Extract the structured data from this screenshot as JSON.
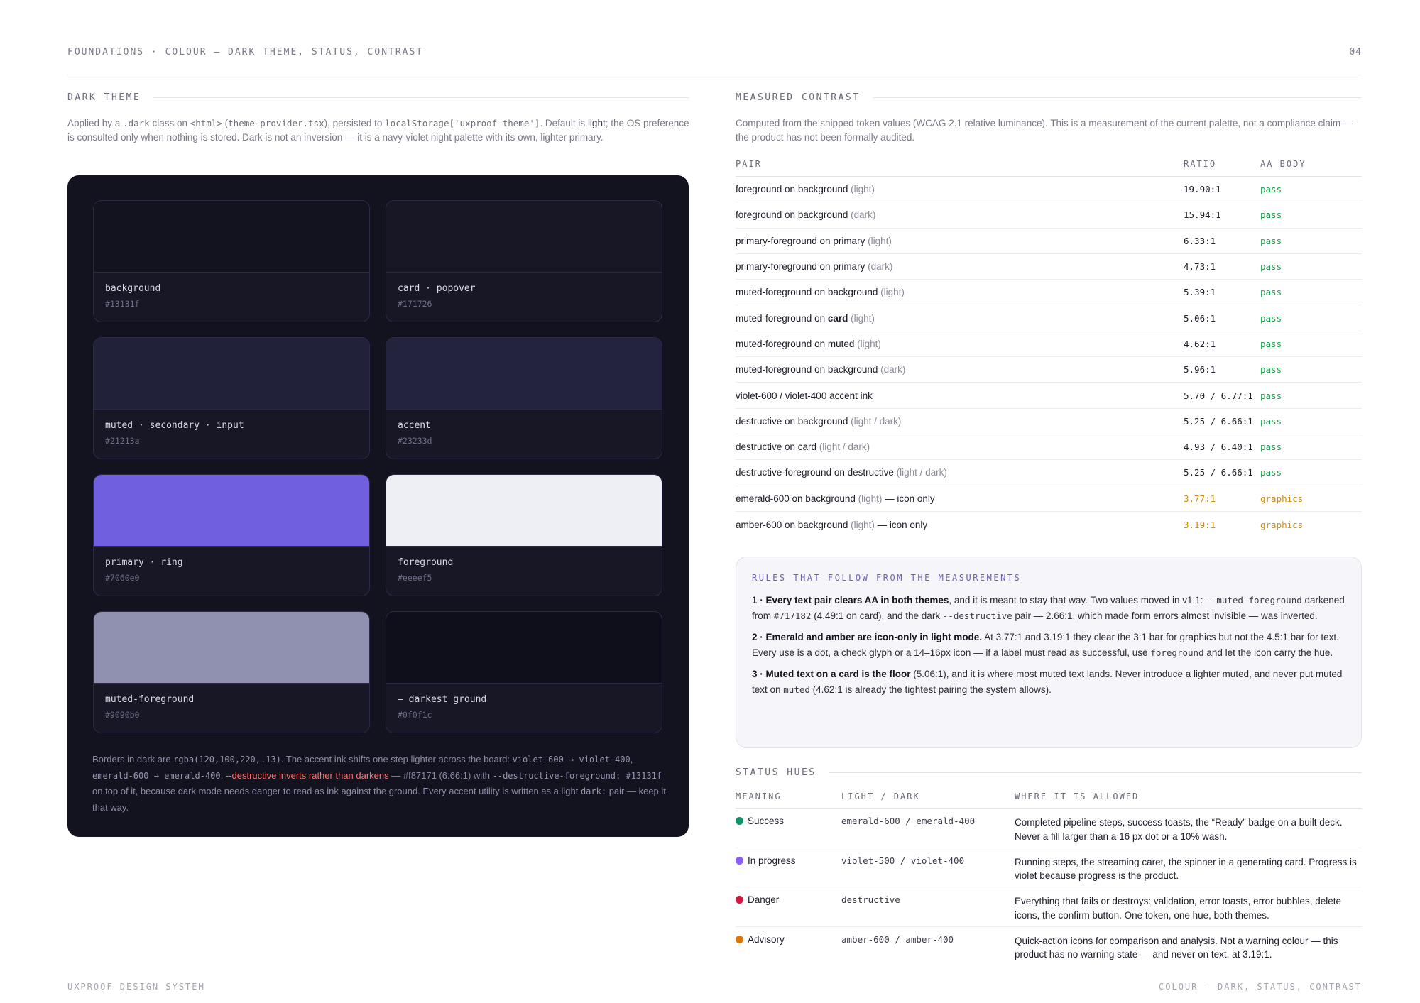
{
  "header": {
    "title": "FOUNDATIONS · COLOUR — DARK THEME, STATUS, CONTRAST",
    "page": "04"
  },
  "footer": {
    "left": "UXPROOF DESIGN SYSTEM",
    "right": "COLOUR — DARK, STATUS, CONTRAST"
  },
  "dark_theme": {
    "heading": "DARK THEME",
    "lead": [
      {
        "t": "Applied by a "
      },
      {
        "t": ".dark",
        "code": true
      },
      {
        "t": " class on "
      },
      {
        "t": "<html>",
        "code": true
      },
      {
        "t": " ("
      },
      {
        "t": "theme-provider.tsx",
        "code": true
      },
      {
        "t": "), persisted to "
      },
      {
        "t": "localStorage['uxproof-theme']",
        "code": true
      },
      {
        "t": ". Default is "
      },
      {
        "t": "light",
        "strong": true
      },
      {
        "t": "; the OS preference is consulted only when nothing is stored. Dark is not an inversion — it is a navy-violet night palette with its own, lighter primary."
      }
    ],
    "swatches": [
      {
        "name": "background",
        "hex": "#13131f",
        "fill": "#13131f"
      },
      {
        "name": "card · popover",
        "hex": "#171726",
        "fill": "#171726"
      },
      {
        "name": "muted · secondary · input",
        "hex": "#21213a",
        "fill": "#21213a"
      },
      {
        "name": "accent",
        "hex": "#23233d",
        "fill": "#23233d"
      },
      {
        "name": "primary · ring",
        "hex": "#7060e0",
        "fill": "#7060e0"
      },
      {
        "name": "foreground",
        "hex": "#eeeef5",
        "fill": "#eeeef5"
      },
      {
        "name": "muted-foreground",
        "hex": "#9090b0",
        "fill": "#9090b0"
      },
      {
        "name": "— darkest ground",
        "hex": "#0f0f1c",
        "fill": "#0f0f1c"
      }
    ],
    "note": [
      {
        "t": "Borders in dark are "
      },
      {
        "t": "rgba(120,100,220,.13)",
        "code": true
      },
      {
        "t": ". The accent ink shifts one step lighter across the board: "
      },
      {
        "t": "violet-600 → violet-400",
        "code": true
      },
      {
        "t": ", "
      },
      {
        "t": "emerald-600 → emerald-400",
        "code": true
      },
      {
        "t": ". "
      },
      {
        "t": "--destructive inverts rather than darkens",
        "danger": true
      },
      {
        "t": " — #f87171 (6.66:1) with "
      },
      {
        "t": "--destructive-foreground: #13131f",
        "code": true
      },
      {
        "t": " on top of it, because dark mode needs danger to read as ink against the ground. Every accent utility is written as a light "
      },
      {
        "t": "dark:",
        "code": true
      },
      {
        "t": " pair — keep it that way."
      }
    ]
  },
  "contrast": {
    "heading": "MEASURED CONTRAST",
    "lead": "Computed from the shipped token values (WCAG 2.1 relative luminance). This is a measurement of the current palette, not a compliance claim — the product has not been formally audited.",
    "columns": [
      "PAIR",
      "RATIO",
      "AA BODY"
    ],
    "rows": [
      {
        "pair": [
          {
            "t": "foreground on background "
          },
          {
            "t": "(light)",
            "note": true
          }
        ],
        "ratio": "19.90:1",
        "aa": "pass",
        "status": "pass"
      },
      {
        "pair": [
          {
            "t": "foreground on background "
          },
          {
            "t": "(dark)",
            "note": true
          }
        ],
        "ratio": "15.94:1",
        "aa": "pass",
        "status": "pass"
      },
      {
        "pair": [
          {
            "t": "primary-foreground on primary "
          },
          {
            "t": "(light)",
            "note": true
          }
        ],
        "ratio": "6.33:1",
        "aa": "pass",
        "status": "pass"
      },
      {
        "pair": [
          {
            "t": "primary-foreground on primary "
          },
          {
            "t": "(dark)",
            "note": true
          }
        ],
        "ratio": "4.73:1",
        "aa": "pass",
        "status": "pass"
      },
      {
        "pair": [
          {
            "t": "muted-foreground on background "
          },
          {
            "t": "(light)",
            "note": true
          }
        ],
        "ratio": "5.39:1",
        "aa": "pass",
        "status": "pass"
      },
      {
        "pair": [
          {
            "t": "muted-foreground on "
          },
          {
            "t": "card",
            "strong": true
          },
          {
            "t": " "
          },
          {
            "t": "(light)",
            "note": true
          }
        ],
        "ratio": "5.06:1",
        "aa": "pass",
        "status": "pass"
      },
      {
        "pair": [
          {
            "t": "muted-foreground on muted "
          },
          {
            "t": "(light)",
            "note": true
          }
        ],
        "ratio": "4.62:1",
        "aa": "pass",
        "status": "pass"
      },
      {
        "pair": [
          {
            "t": "muted-foreground on background "
          },
          {
            "t": "(dark)",
            "note": true
          }
        ],
        "ratio": "5.96:1",
        "aa": "pass",
        "status": "pass"
      },
      {
        "pair": [
          {
            "t": "violet-600 / violet-400 accent ink"
          }
        ],
        "ratio": "5.70 / 6.77:1",
        "aa": "pass",
        "status": "pass"
      },
      {
        "pair": [
          {
            "t": "destructive on background "
          },
          {
            "t": "(light / dark)",
            "note": true
          }
        ],
        "ratio": "5.25 / 6.66:1",
        "aa": "pass",
        "status": "pass"
      },
      {
        "pair": [
          {
            "t": "destructive on card "
          },
          {
            "t": "(light / dark)",
            "note": true
          }
        ],
        "ratio": "4.93 / 6.40:1",
        "aa": "pass",
        "status": "pass"
      },
      {
        "pair": [
          {
            "t": "destructive-foreground on destructive "
          },
          {
            "t": "(light / dark)",
            "note": true
          }
        ],
        "ratio": "5.25 / 6.66:1",
        "aa": "pass",
        "status": "pass"
      },
      {
        "pair": [
          {
            "t": "emerald-600 on background "
          },
          {
            "t": "(light)",
            "note": true
          },
          {
            "t": " — icon only"
          }
        ],
        "ratio": "3.77:1",
        "aa": "graphics",
        "status": "warn"
      },
      {
        "pair": [
          {
            "t": "amber-600 on background "
          },
          {
            "t": "(light)",
            "note": true
          },
          {
            "t": " — icon only"
          }
        ],
        "ratio": "3.19:1",
        "aa": "graphics",
        "status": "warn"
      }
    ]
  },
  "rules": {
    "title": "RULES THAT FOLLOW FROM THE MEASUREMENTS",
    "items": [
      [
        {
          "t": "1 · Every text pair clears AA in both themes",
          "strong": true
        },
        {
          "t": ", and it is meant to stay that way. Two values moved in v1.1: "
        },
        {
          "t": "--muted-foreground",
          "code": true
        },
        {
          "t": " darkened from "
        },
        {
          "t": "#717182",
          "code": true
        },
        {
          "t": " (4.49:1 on card), and the dark "
        },
        {
          "t": "--destructive",
          "code": true
        },
        {
          "t": " pair — 2.66:1, which made form errors almost invisible — was inverted."
        }
      ],
      [
        {
          "t": "2 · Emerald and amber are icon-only in light mode.",
          "strong": true
        },
        {
          "t": " At 3.77:1 and 3.19:1 they clear the 3:1 bar for graphics but not the 4.5:1 bar for text. Every use is a dot, a check glyph or a 14–16px icon — if a label must read as successful, use "
        },
        {
          "t": "foreground",
          "code": true
        },
        {
          "t": " and let the icon carry the hue."
        }
      ],
      [
        {
          "t": "3 · Muted text on a card is the floor",
          "strong": true
        },
        {
          "t": " (5.06:1), and it is where most muted text lands. Never introduce a lighter muted, and never put muted text on "
        },
        {
          "t": "muted",
          "code": true
        },
        {
          "t": " (4.62:1 is already the tightest pairing the system allows)."
        }
      ]
    ]
  },
  "status": {
    "heading": "STATUS HUES",
    "columns": [
      "MEANING",
      "LIGHT / DARK",
      "WHERE IT IS ALLOWED"
    ],
    "rows": [
      {
        "meaning": "Success",
        "color": "#10946b",
        "light_dark": "emerald-600 / emerald-400",
        "where": "Completed pipeline steps, success toasts, the “Ready” badge on a built deck. Never a fill larger than a 16 px dot or a 10% wash."
      },
      {
        "meaning": "In progress",
        "color": "#8b5cf6",
        "light_dark": "violet-500 / violet-400",
        "where": "Running steps, the streaming caret, the spinner in a generating card. Progress is violet because progress is the product."
      },
      {
        "meaning": "Danger",
        "color": "#d4183d",
        "light_dark": "destructive",
        "where": "Everything that fails or destroys: validation, error toasts, error bubbles, delete icons, the confirm button. One token, one hue, both themes."
      },
      {
        "meaning": "Advisory",
        "color": "#d97706",
        "light_dark": "amber-600 / amber-400",
        "where": "Quick-action icons for comparison and analysis. Not a warning colour — this product has no warning state — and never on text, at 3.19:1."
      }
    ]
  }
}
